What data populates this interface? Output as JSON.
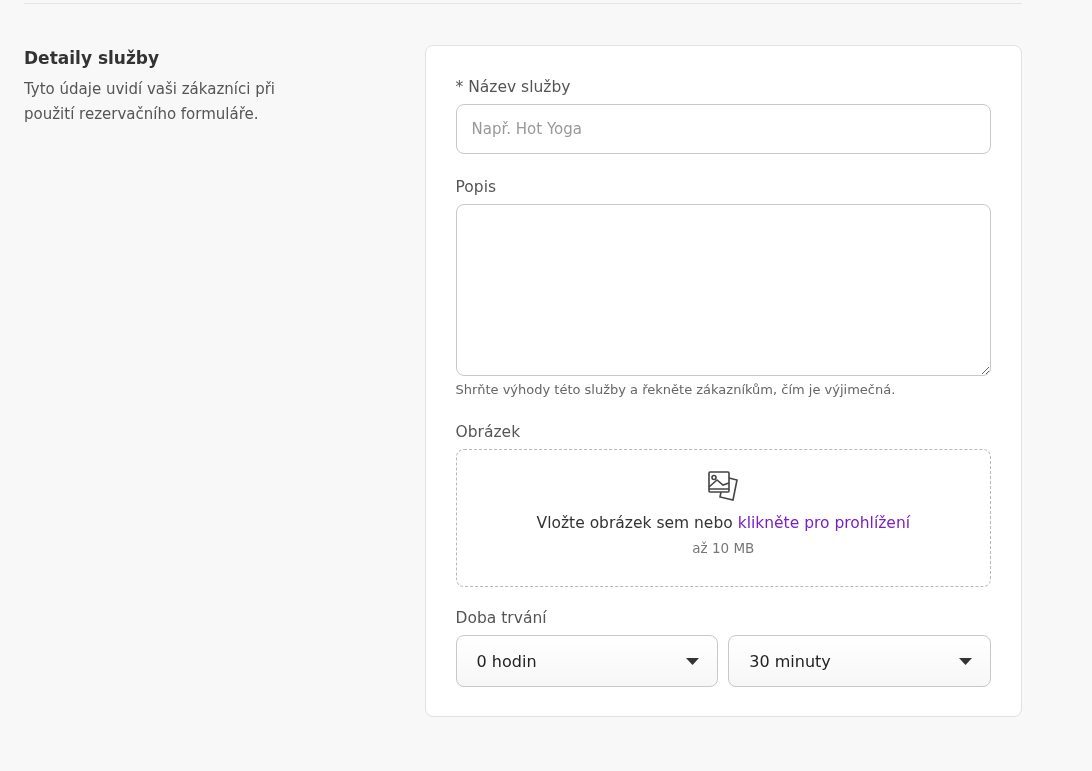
{
  "section": {
    "title": "Detaily služby",
    "description": "Tyto údaje uvidí vaši zákazníci při použití rezervačního formuláře."
  },
  "name_field": {
    "label": "* Název služby",
    "placeholder": "Např. Hot Yoga"
  },
  "description_field": {
    "label": "Popis",
    "hint": "Shrňte výhody této služby a řekněte zákazníkům, čím je výjimečná."
  },
  "image_field": {
    "label": "Obrázek",
    "drop_text": "Vložte obrázek sem nebo",
    "browse_link": "klikněte pro prohlížení",
    "size_limit": "až 10 MB"
  },
  "duration": {
    "label": "Doba trvání",
    "selects": [
      {
        "value": "0 hodin"
      },
      {
        "value": "30 minuty"
      }
    ]
  }
}
